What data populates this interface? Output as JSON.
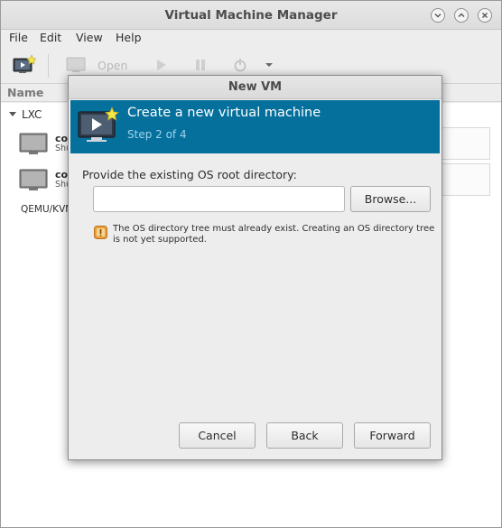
{
  "window": {
    "title": "Virtual Machine Manager"
  },
  "menubar": {
    "items": [
      "File",
      "Edit",
      "View",
      "Help"
    ]
  },
  "toolbar": {
    "new_icon": "new-vm-monitor-icon",
    "open_label": "Open",
    "run_icon": "play-icon",
    "pause_icon": "pause-icon",
    "shutdown_icon": "power-icon",
    "menu_icon": "dropdown-arrow-icon"
  },
  "vm_list": {
    "column_header": "Name",
    "group_lxc": "LXC",
    "vms": [
      {
        "name": "co",
        "state": "Shu"
      },
      {
        "name": "co",
        "state": "Shu"
      }
    ],
    "group_qemu": "QEMU/KVM"
  },
  "dialog": {
    "title": "New VM",
    "header_title": "Create a new virtual machine",
    "header_step": "Step 2 of 4",
    "field_label": "Provide the existing OS root directory:",
    "path_value": "",
    "browse_label": "Browse...",
    "warning_text": "The OS directory tree must already exist. Creating an OS directory tree is not yet supported.",
    "cancel_label": "Cancel",
    "back_label": "Back",
    "forward_label": "Forward"
  },
  "colors": {
    "header_bg": "#06709d",
    "header_step": "#9ed3ea",
    "warning_icon": "#e9a23b"
  }
}
